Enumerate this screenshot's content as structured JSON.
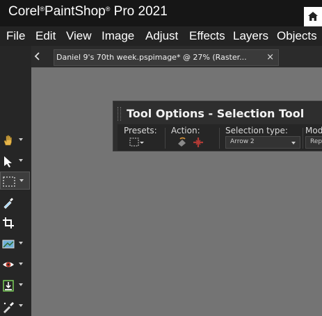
{
  "app": {
    "title_part1": "Corel",
    "reg_mark": "®",
    "title_part2": "PaintShop",
    "title_part3": "Pro 2021"
  },
  "menu": [
    {
      "label": "File"
    },
    {
      "label": "Edit"
    },
    {
      "label": "View"
    },
    {
      "label": "Image"
    },
    {
      "label": "Adjust"
    },
    {
      "label": "Effects"
    },
    {
      "label": "Layers"
    },
    {
      "label": "Objects"
    }
  ],
  "document_tab": {
    "label": "Daniel 9's 70th week.pspimage* @  27% (Raster...",
    "close_glyph": "×"
  },
  "tools": [
    {
      "name": "pan-tool",
      "icon": "hand-icon"
    },
    {
      "name": "pick-tool",
      "icon": "arrow-pointer-icon"
    },
    {
      "name": "selection-tool",
      "icon": "selection-marquee-icon",
      "selected": true
    },
    {
      "name": "dropper-tool",
      "icon": "eyedropper-icon"
    },
    {
      "name": "crop-tool",
      "icon": "crop-icon"
    },
    {
      "name": "straighten-tool",
      "icon": "straighten-icon"
    },
    {
      "name": "red-eye-tool",
      "icon": "eye-icon"
    },
    {
      "name": "makeover-tool",
      "icon": "makeover-icon"
    },
    {
      "name": "clone-tool",
      "icon": "brush-icon"
    }
  ],
  "tool_options": {
    "title": "Tool Options - Selection Tool",
    "presets_label": "Presets:",
    "action_label": "Action:",
    "selection_type_label": "Selection type:",
    "selection_type_value": "Arrow 2",
    "mode_label": "Mode:",
    "mode_value": "Replace"
  },
  "colors": {
    "canvas": "#747474",
    "titlebar": "#161616",
    "menubar": "#232323",
    "accent_red": "#c0392b"
  }
}
